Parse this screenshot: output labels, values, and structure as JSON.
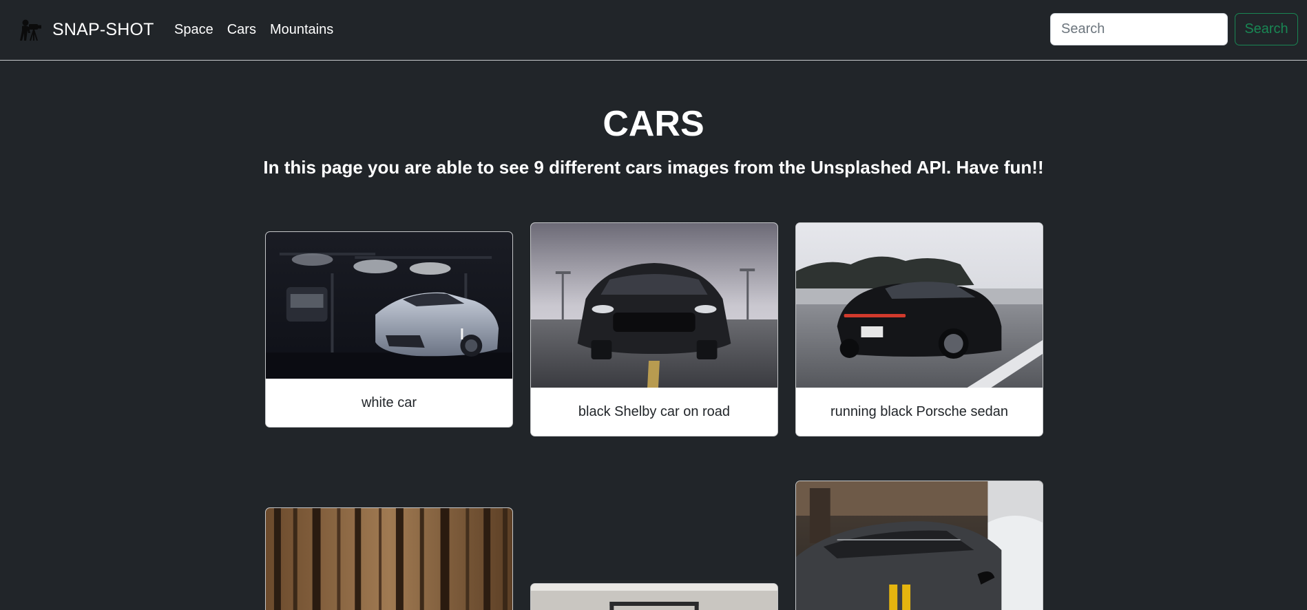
{
  "brand": {
    "name": "SNAP-SHOT",
    "icon": "photographer-icon"
  },
  "nav": {
    "links": [
      {
        "label": "Space"
      },
      {
        "label": "Cars"
      },
      {
        "label": "Mountains"
      }
    ]
  },
  "search": {
    "placeholder": "Search",
    "value": "",
    "button_label": "Search"
  },
  "colors": {
    "background": "#212529",
    "accent": "#198754"
  },
  "main": {
    "title": "CARS",
    "subtitle": "In this page you are able to see 9 different cars images from the Unsplashed API. Have fun!!"
  },
  "gallery": {
    "cards": [
      {
        "caption": "white car"
      },
      {
        "caption": "black Shelby car on road"
      },
      {
        "caption": "running black Porsche sedan"
      },
      {
        "caption": ""
      },
      {
        "caption": ""
      },
      {
        "caption": ""
      }
    ]
  }
}
